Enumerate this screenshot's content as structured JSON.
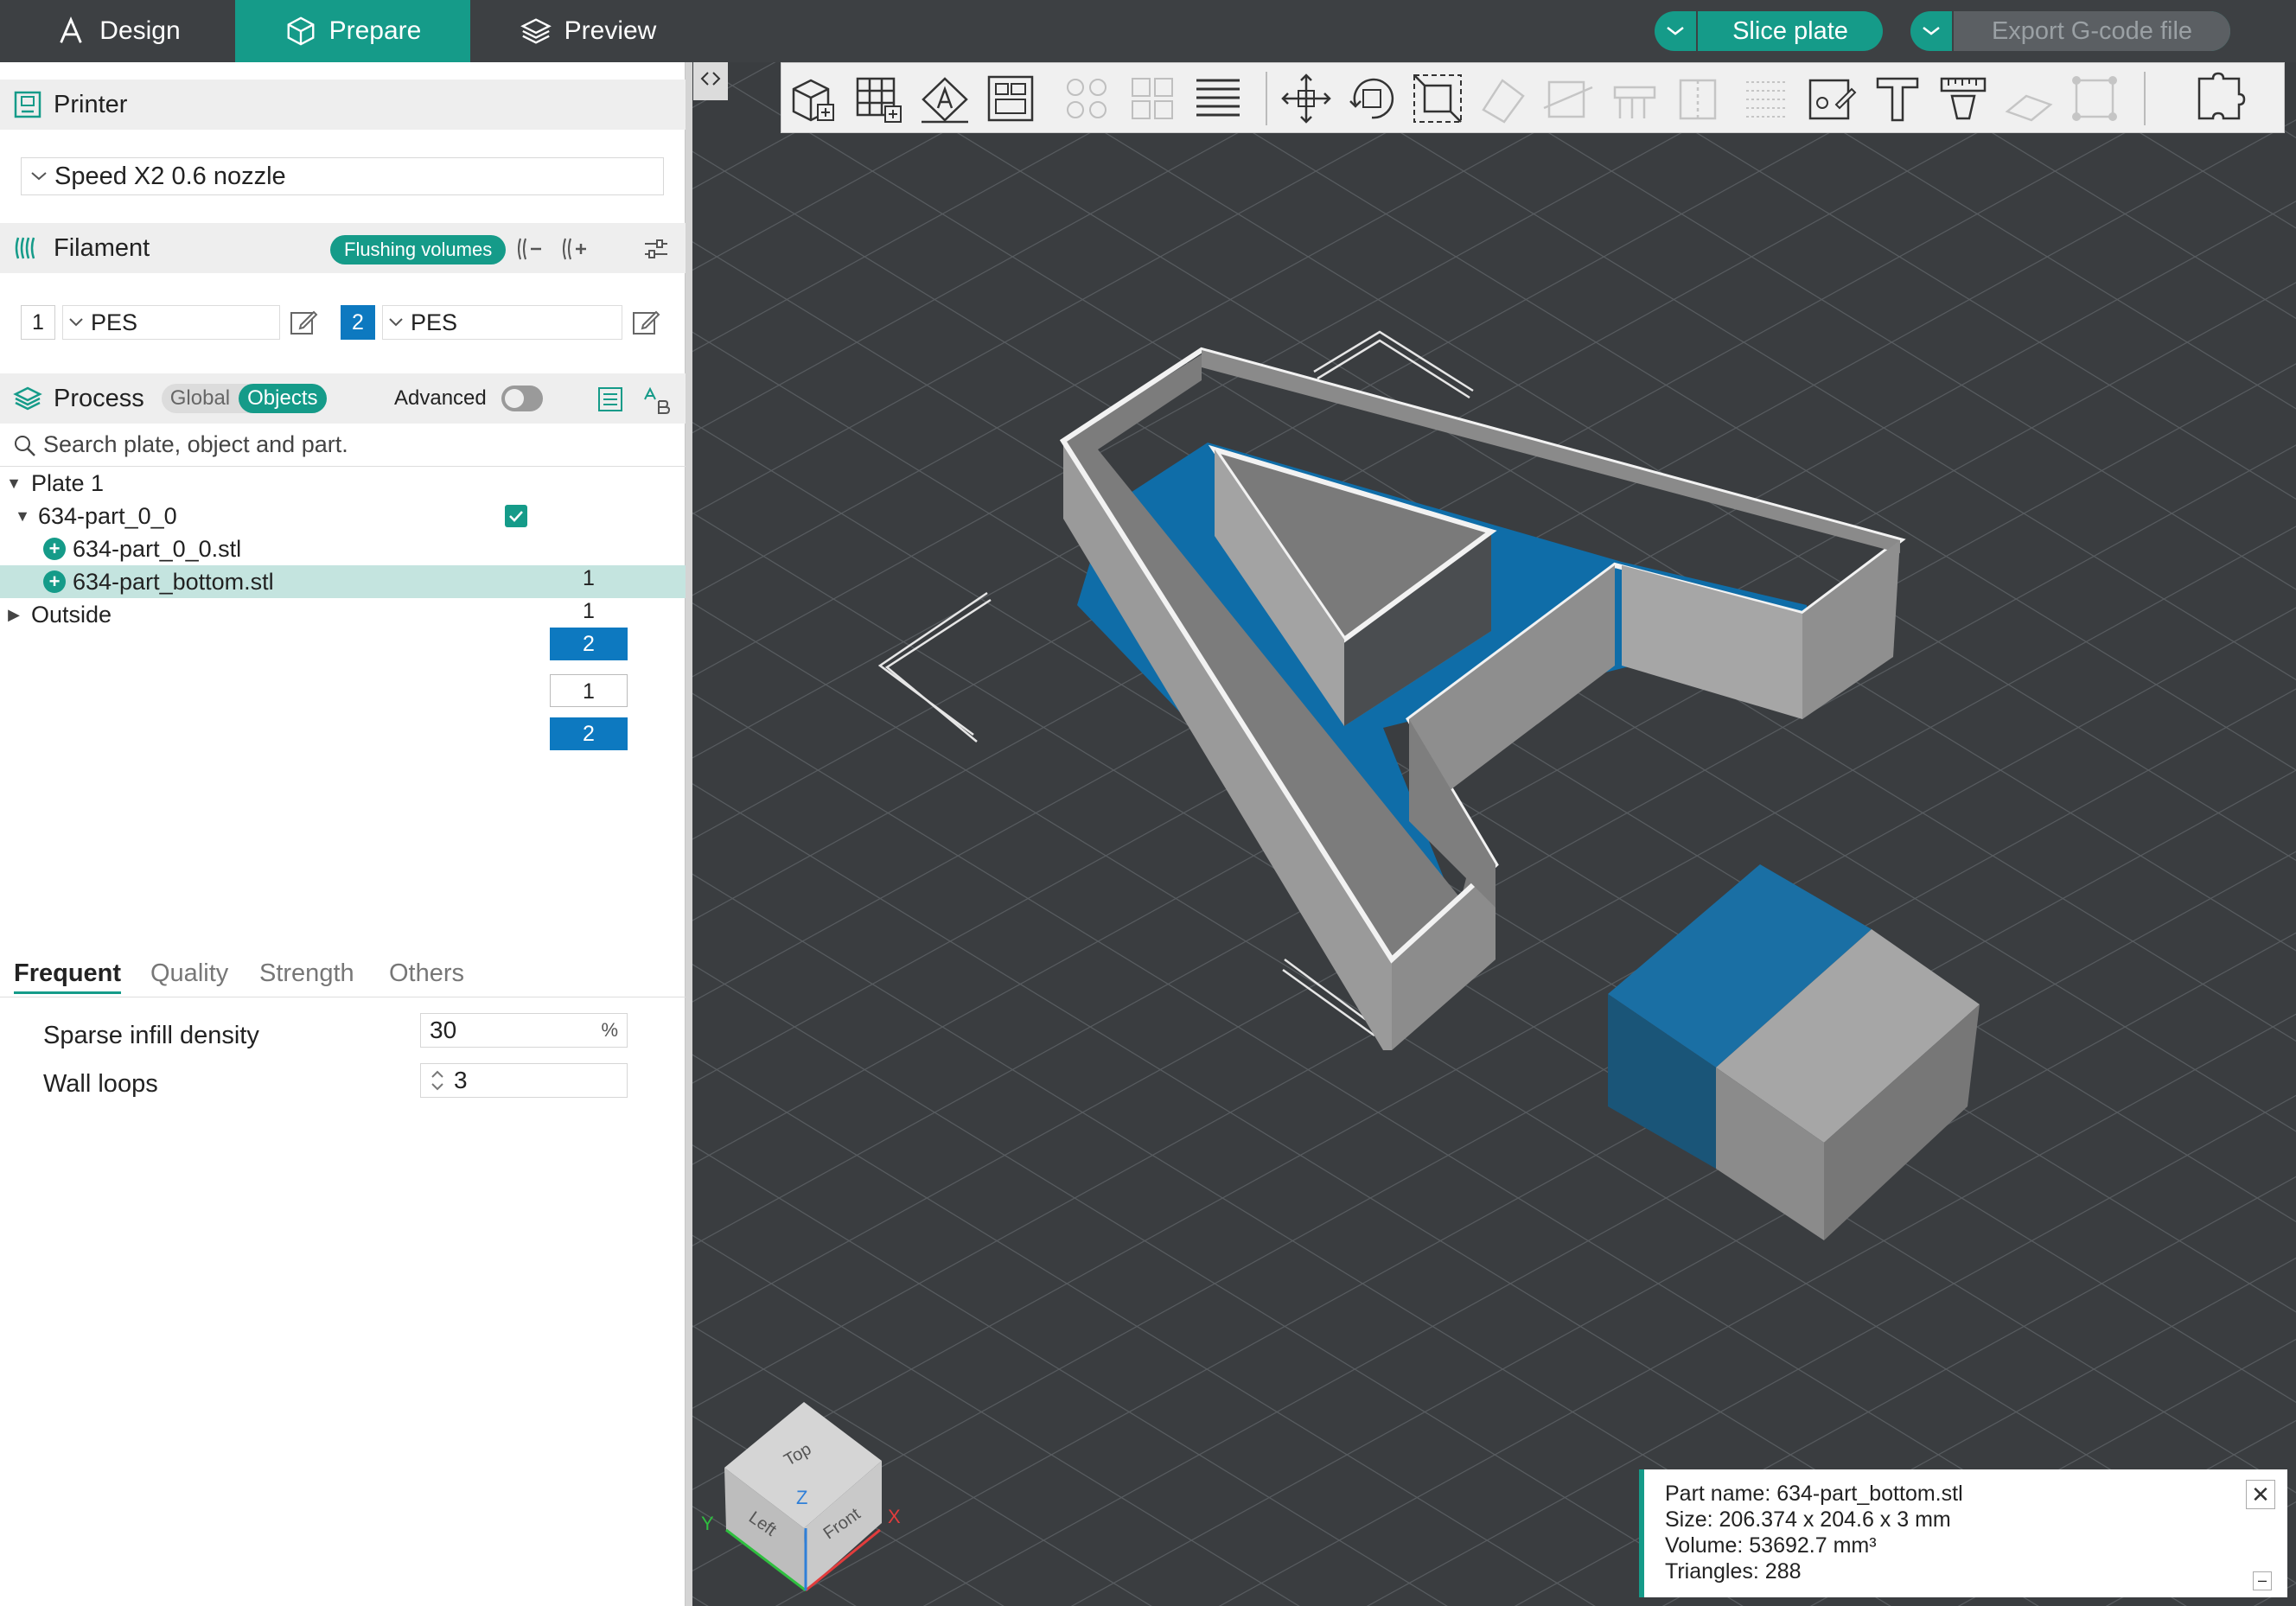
{
  "tabs": {
    "design": "Design",
    "prepare": "Prepare",
    "preview": "Preview"
  },
  "actions": {
    "slice": "Slice plate",
    "export": "Export G-code file"
  },
  "colors": {
    "accent": "#159b89",
    "selection_blue": "#0d79c0",
    "viewport_bg": "#3a3d40"
  },
  "printer": {
    "title": "Printer",
    "selected": "Speed X2 0.6 nozzle"
  },
  "filament": {
    "title": "Filament",
    "flushing_button": "Flushing volumes",
    "slots": [
      {
        "number": "1",
        "material": "PES"
      },
      {
        "number": "2",
        "material": "PES"
      }
    ]
  },
  "process": {
    "title": "Process",
    "mode_global": "Global",
    "mode_objects": "Objects",
    "advanced_label": "Advanced"
  },
  "search": {
    "placeholder": "Search plate, object and part."
  },
  "tree": {
    "plate": "Plate 1",
    "object": "634-part_0_0",
    "parts": [
      "634-part_0_0.stl",
      "634-part_bottom.stl"
    ],
    "outside": "Outside",
    "extruders": [
      "1",
      "1",
      "2"
    ],
    "dropdown_options": [
      "1",
      "2"
    ]
  },
  "param_tabs": [
    "Frequent",
    "Quality",
    "Strength",
    "Others"
  ],
  "params": {
    "infill_label": "Sparse infill density",
    "infill_value": "30",
    "infill_unit": "%",
    "walls_label": "Wall loops",
    "walls_value": "3"
  },
  "navcube": {
    "top": "Top",
    "left": "Left",
    "front": "Front",
    "axis_x": "X",
    "axis_y": "Y",
    "axis_z": "Z"
  },
  "info": {
    "part_name": "Part name: 634-part_bottom.stl",
    "size": "Size: 206.374 x 204.6 x 3 mm",
    "volume": "Volume: 53692.7 mm³",
    "triangles": "Triangles: 288"
  }
}
